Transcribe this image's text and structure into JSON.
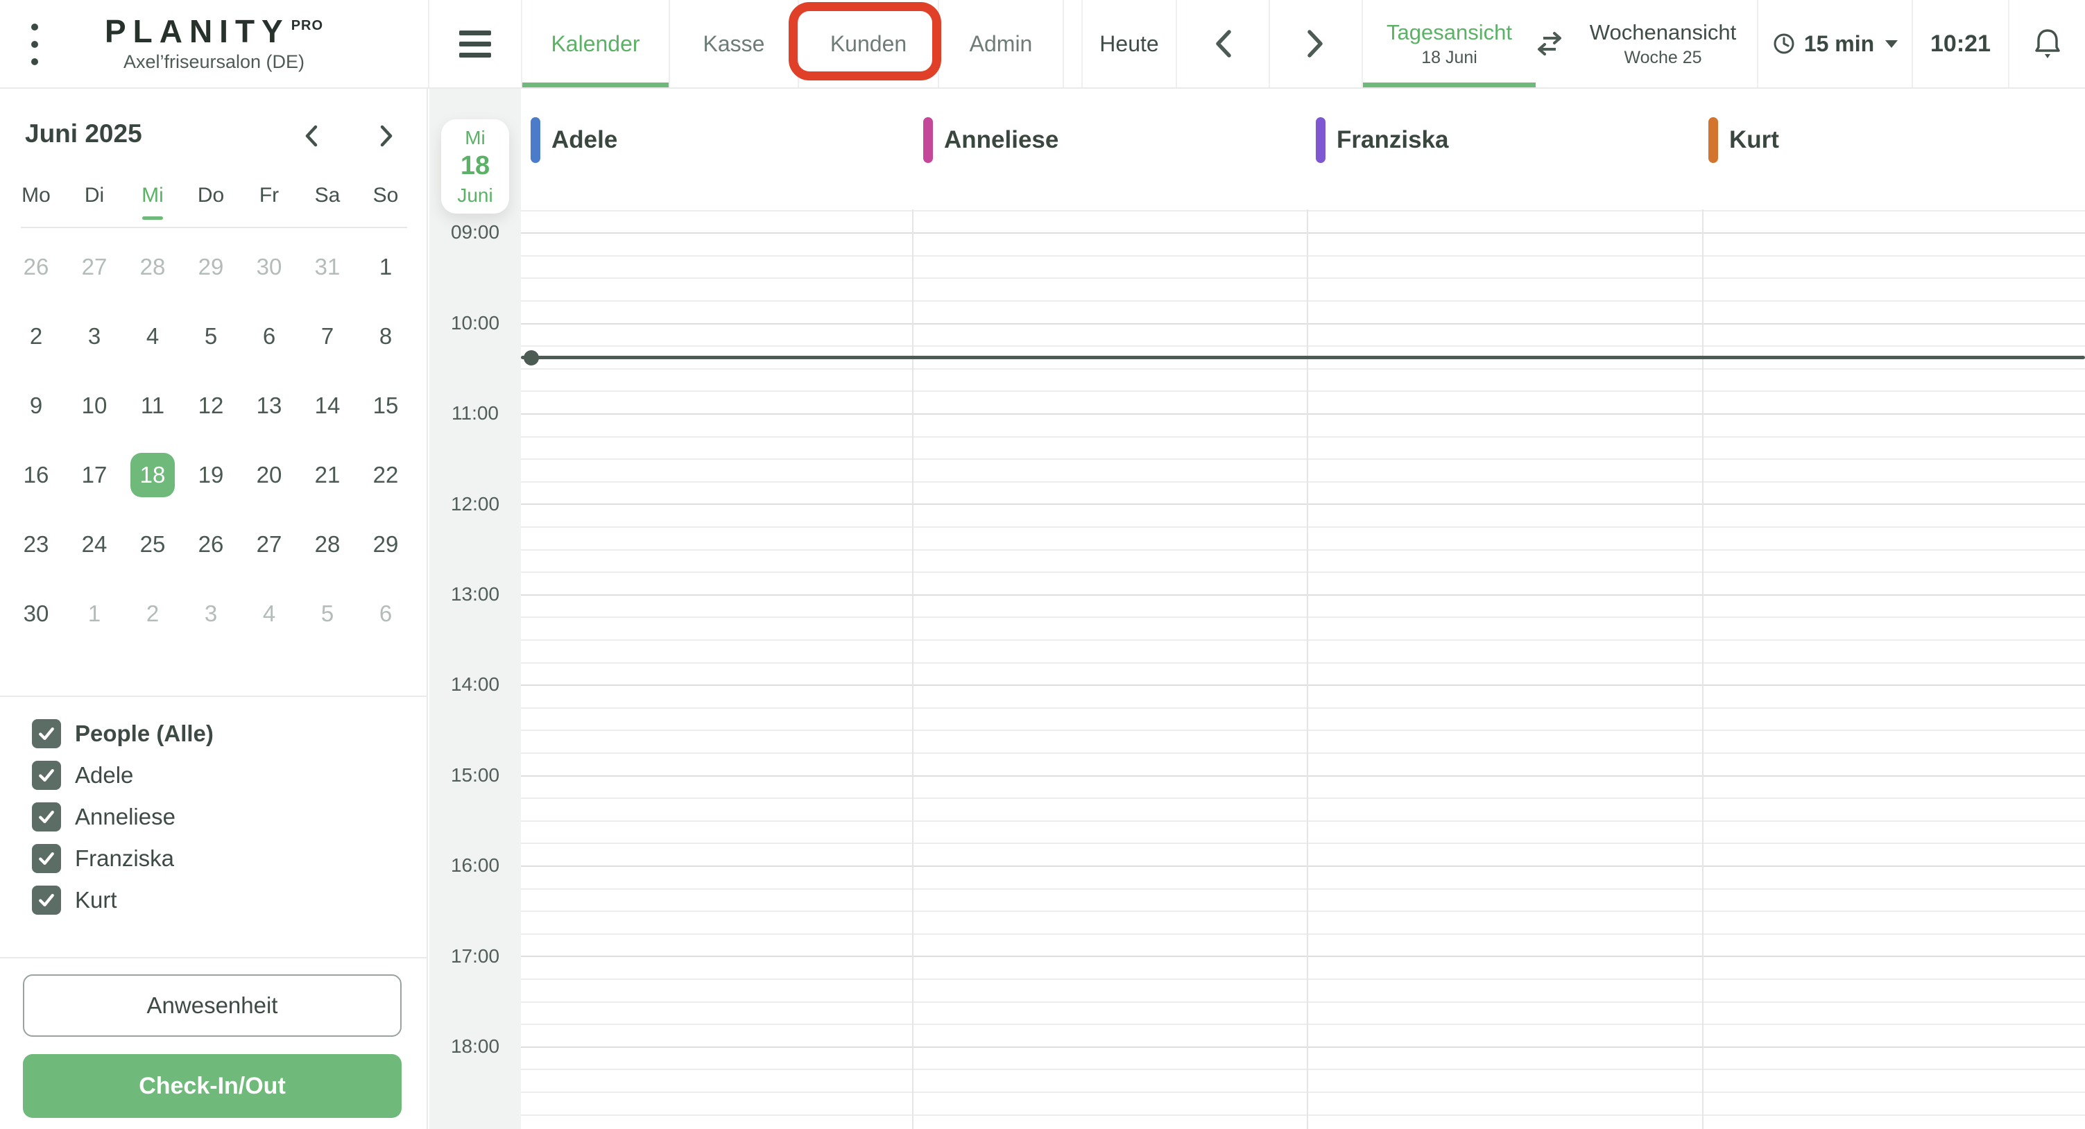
{
  "topbar": {
    "logo": {
      "text": "PLANITY",
      "sup": "PRO",
      "subtitle": "Axel’friseursalon (DE)"
    },
    "tabs": [
      {
        "id": "kalender",
        "label": "Kalender",
        "active": true,
        "highlighted": false
      },
      {
        "id": "kasse",
        "label": "Kasse",
        "active": false,
        "highlighted": false
      },
      {
        "id": "kunden",
        "label": "Kunden",
        "active": false,
        "highlighted": true
      },
      {
        "id": "admin",
        "label": "Admin",
        "active": false,
        "highlighted": false
      }
    ],
    "heute": "Heute",
    "day_view": {
      "label": "Tagesansicht",
      "sub": "18 Juni",
      "active": true
    },
    "week_view": {
      "label": "Wochenansicht",
      "sub": "Woche 25",
      "active": false
    },
    "interval": "15 min",
    "time": "10:21"
  },
  "sidebar": {
    "month": "Juni 2025",
    "weekdays": [
      {
        "label": "Mo"
      },
      {
        "label": "Di"
      },
      {
        "label": "Mi",
        "active": true
      },
      {
        "label": "Do"
      },
      {
        "label": "Fr"
      },
      {
        "label": "Sa"
      },
      {
        "label": "So"
      }
    ],
    "weeks": [
      [
        {
          "d": "26",
          "muted": true
        },
        {
          "d": "27",
          "muted": true
        },
        {
          "d": "28",
          "muted": true
        },
        {
          "d": "29",
          "muted": true
        },
        {
          "d": "30",
          "muted": true
        },
        {
          "d": "31",
          "muted": true
        },
        {
          "d": "1"
        }
      ],
      [
        {
          "d": "2"
        },
        {
          "d": "3"
        },
        {
          "d": "4"
        },
        {
          "d": "5"
        },
        {
          "d": "6"
        },
        {
          "d": "7"
        },
        {
          "d": "8"
        }
      ],
      [
        {
          "d": "9"
        },
        {
          "d": "10"
        },
        {
          "d": "11"
        },
        {
          "d": "12"
        },
        {
          "d": "13"
        },
        {
          "d": "14"
        },
        {
          "d": "15"
        }
      ],
      [
        {
          "d": "16"
        },
        {
          "d": "17"
        },
        {
          "d": "18",
          "selected": true
        },
        {
          "d": "19"
        },
        {
          "d": "20"
        },
        {
          "d": "21"
        },
        {
          "d": "22"
        }
      ],
      [
        {
          "d": "23"
        },
        {
          "d": "24"
        },
        {
          "d": "25"
        },
        {
          "d": "26"
        },
        {
          "d": "27"
        },
        {
          "d": "28"
        },
        {
          "d": "29"
        }
      ],
      [
        {
          "d": "30"
        },
        {
          "d": "1",
          "muted": true
        },
        {
          "d": "2",
          "muted": true
        },
        {
          "d": "3",
          "muted": true
        },
        {
          "d": "4",
          "muted": true
        },
        {
          "d": "5",
          "muted": true
        },
        {
          "d": "6",
          "muted": true
        }
      ]
    ],
    "filters": {
      "all": {
        "label": "People (Alle)",
        "checked": true
      },
      "people": [
        {
          "name": "Adele",
          "checked": true
        },
        {
          "name": "Anneliese",
          "checked": true
        },
        {
          "name": "Franziska",
          "checked": true
        },
        {
          "name": "Kurt",
          "checked": true
        }
      ]
    },
    "attendance": "Anwesenheit",
    "checkin": "Check-In/Out"
  },
  "calendar": {
    "date_card": {
      "weekday": "Mi",
      "day": "18",
      "month": "Juni"
    },
    "columns": [
      {
        "name": "Adele",
        "color": "#4a7cc9"
      },
      {
        "name": "Anneliese",
        "color": "#c4479a"
      },
      {
        "name": "Franziska",
        "color": "#7d58d2"
      },
      {
        "name": "Kurt",
        "color": "#d4752f"
      }
    ],
    "hours": [
      "09:00",
      "10:00",
      "11:00",
      "12:00",
      "13:00",
      "14:00",
      "15:00",
      "16:00",
      "17:00",
      "18:00"
    ],
    "now_indicator_time": "10:21"
  },
  "colors": {
    "accent_green": "#6fb97b",
    "accent_green_text": "#5bb266",
    "highlight_red": "#e14028",
    "now_line": "#4c5b54"
  }
}
